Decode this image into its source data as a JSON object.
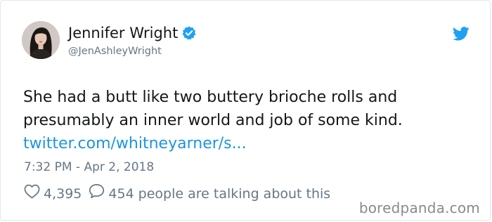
{
  "user": {
    "display_name": "Jennifer Wright",
    "handle": "@JenAshleyWright",
    "verified": true
  },
  "tweet": {
    "text_lines": [
      "She had a butt like two buttery brioche rolls and",
      "presumably an inner world and job of some kind."
    ],
    "link_text": "twitter.com/whitneyarner/s...",
    "timestamp": "7:32 PM - Apr 2, 2018"
  },
  "stats": {
    "likes": "4,395",
    "replies": "454",
    "talking_label": "people are talking about this"
  },
  "icons": {
    "verified": "verified-badge-icon",
    "brand": "twitter-bird-icon",
    "like": "heart-icon",
    "reply": "speech-bubble-icon"
  },
  "colors": {
    "link": "#1b95e0",
    "verified": "#1da1f2",
    "muted": "#657786",
    "text": "#14171a",
    "watermark": "#8a8a8a"
  },
  "watermark": "boredpanda.com"
}
